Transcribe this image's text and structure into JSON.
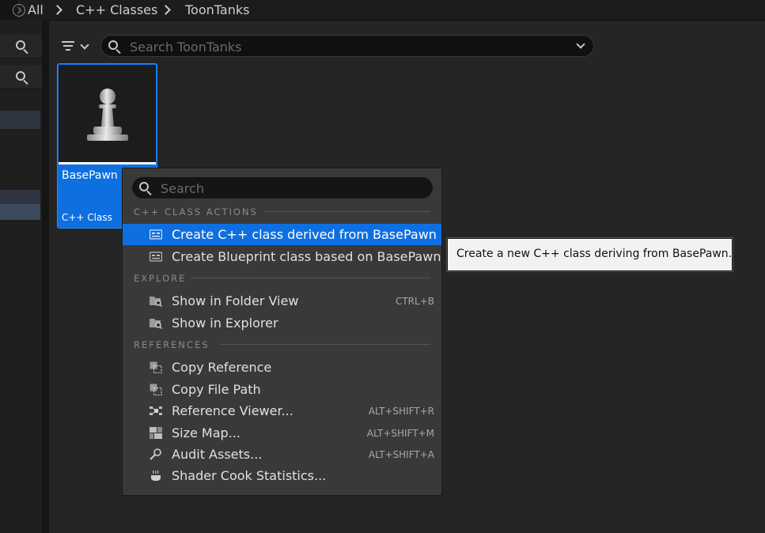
{
  "breadcrumb": {
    "items": [
      "All",
      "C++ Classes",
      "ToonTanks"
    ]
  },
  "toolbar": {
    "search_placeholder": "Search ToonTanks"
  },
  "asset": {
    "name": "BasePawn",
    "type": "C++ Class"
  },
  "context_menu": {
    "search_placeholder": "Search",
    "sections": {
      "cpp_class_actions": "C++ CLASS ACTIONS",
      "explore": "EXPLORE",
      "references": "REFERENCES"
    },
    "items": [
      {
        "label": "Create C++ class derived from BasePawn",
        "shortcut": "",
        "icon": "cpp-class-icon",
        "highlighted": true
      },
      {
        "label": "Create Blueprint class based on BasePawn",
        "shortcut": "",
        "icon": "blueprint-class-icon"
      },
      {
        "label": "Show in Folder View",
        "shortcut": "CTRL+B",
        "icon": "folder-search-icon"
      },
      {
        "label": "Show in Explorer",
        "shortcut": "",
        "icon": "folder-search-icon"
      },
      {
        "label": "Copy Reference",
        "shortcut": "",
        "icon": "copy-icon"
      },
      {
        "label": "Copy File Path",
        "shortcut": "",
        "icon": "copy-icon"
      },
      {
        "label": "Reference Viewer...",
        "shortcut": "ALT+SHIFT+R",
        "icon": "reference-viewer-icon"
      },
      {
        "label": "Size Map...",
        "shortcut": "ALT+SHIFT+M",
        "icon": "size-map-icon"
      },
      {
        "label": "Audit Assets...",
        "shortcut": "ALT+SHIFT+A",
        "icon": "audit-icon"
      },
      {
        "label": "Shader Cook Statistics...",
        "shortcut": "",
        "icon": "shader-cook-icon"
      }
    ]
  },
  "tooltip": {
    "text": "Create a new C++ class deriving from BasePawn."
  },
  "colors": {
    "highlight": "#0e70e0",
    "menu_bg": "#393939",
    "panel_bg": "#252525"
  }
}
